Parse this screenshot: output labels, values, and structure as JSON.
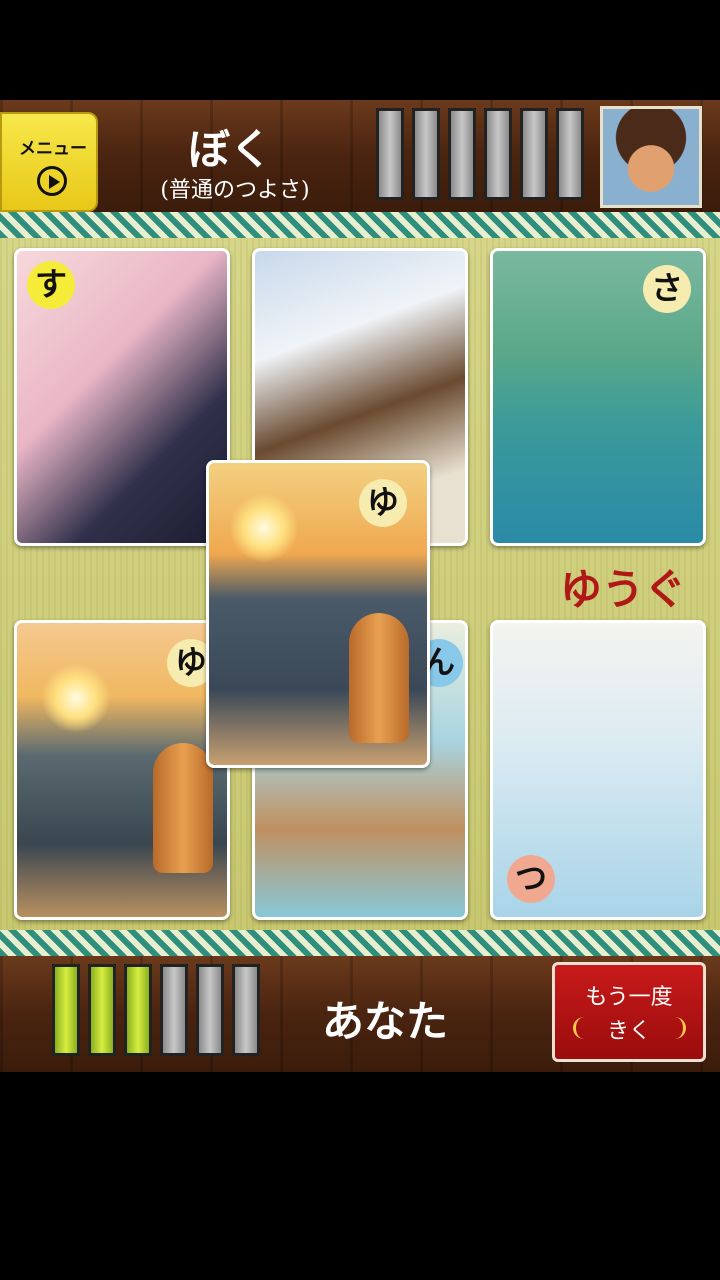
{
  "header": {
    "menu_label": "メニュー",
    "opponent_name": "ぼく",
    "opponent_strength": "(普通のつよさ)",
    "opponent_meter": [
      0,
      0,
      0,
      0,
      0,
      0
    ]
  },
  "cards": [
    {
      "letter": "す"
    },
    {
      "letter": ""
    },
    {
      "letter": "さ"
    },
    {
      "letter": "ゆ"
    },
    {
      "letter": "ん"
    },
    {
      "letter": "つ"
    }
  ],
  "flying_card": {
    "letter": "ゆ"
  },
  "reading_hint": "ゆうぐ",
  "footer": {
    "player_name": "あなた",
    "player_meter": [
      1,
      1,
      1,
      0,
      0,
      0
    ],
    "replay_line1": "もう一度",
    "replay_line2": "きく"
  },
  "colors": {
    "accent_red": "#b01818",
    "meter_on": "#c8e030",
    "menu_yellow": "#f4e040"
  }
}
